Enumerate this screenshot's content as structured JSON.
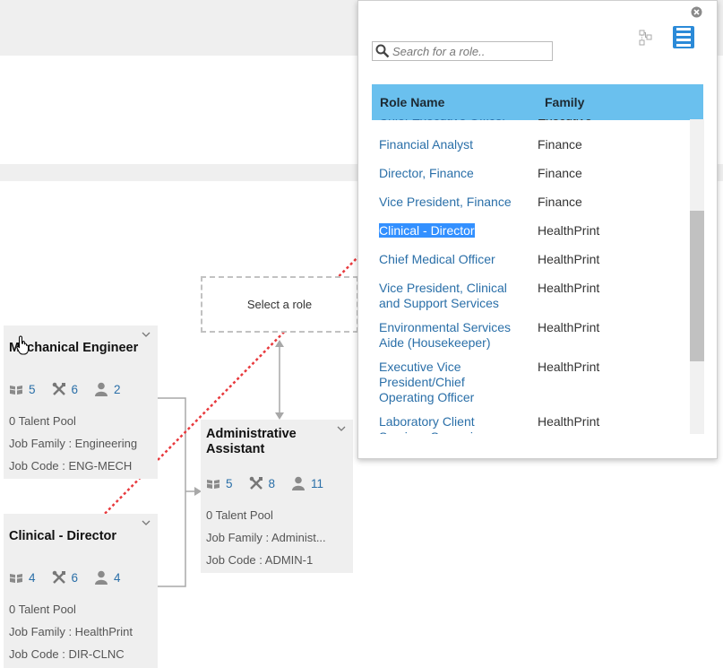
{
  "select_zone": {
    "label": "Select a role"
  },
  "cards": [
    {
      "id": "mech",
      "title": "Mechanical Engineer",
      "courses": "5",
      "skills": "6",
      "people": "2",
      "talent_pool": "0 Talent Pool",
      "job_family": "Job Family : Engineering",
      "job_code": "Job Code : ENG-MECH"
    },
    {
      "id": "clinical",
      "title": "Clinical - Director",
      "courses": "4",
      "skills": "6",
      "people": "4",
      "talent_pool": "0 Talent Pool",
      "job_family": "Job Family : HealthPrint",
      "job_code": "Job Code : DIR-CLNC"
    },
    {
      "id": "admin",
      "title": "Administrative Assistant",
      "courses": "5",
      "skills": "8",
      "people": "11",
      "talent_pool": "0 Talent Pool",
      "job_family": "Job Family : Administ...",
      "job_code": "Job Code : ADMIN-1"
    }
  ],
  "popup": {
    "search_placeholder": "Search for a role..",
    "col_role": "Role Name",
    "col_family": "Family",
    "rows": [
      {
        "name": "Chief Executive Officer",
        "family": "Executive"
      },
      {
        "name": "Financial Analyst",
        "family": "Finance"
      },
      {
        "name": "Director, Finance",
        "family": "Finance"
      },
      {
        "name": "Vice President, Finance",
        "family": "Finance"
      },
      {
        "name": "Clinical - Director",
        "family": "HealthPrint",
        "selected": true
      },
      {
        "name": "Chief Medical Officer",
        "family": "HealthPrint"
      },
      {
        "name": "Vice President, Clinical and Support Services",
        "family": "HealthPrint"
      },
      {
        "name": "Environmental Services Aide (Housekeeper)",
        "family": "HealthPrint"
      },
      {
        "name": "Executive Vice President/Chief Operating Officer",
        "family": "HealthPrint"
      },
      {
        "name": "Laboratory Client Services Supervisor",
        "family": "HealthPrint"
      }
    ]
  },
  "colors": {
    "header_bg": "#6ac0ee",
    "link": "#2a6fa8",
    "selection": "#3390ff",
    "drag_line": "#e8393d",
    "view_button": "#2b8ad8"
  },
  "icons": [
    "book-icon",
    "tools-icon",
    "person-icon",
    "chevron-down-icon",
    "close-icon",
    "search-icon",
    "tree-view-icon",
    "list-view-icon",
    "hand-cursor-icon"
  ]
}
